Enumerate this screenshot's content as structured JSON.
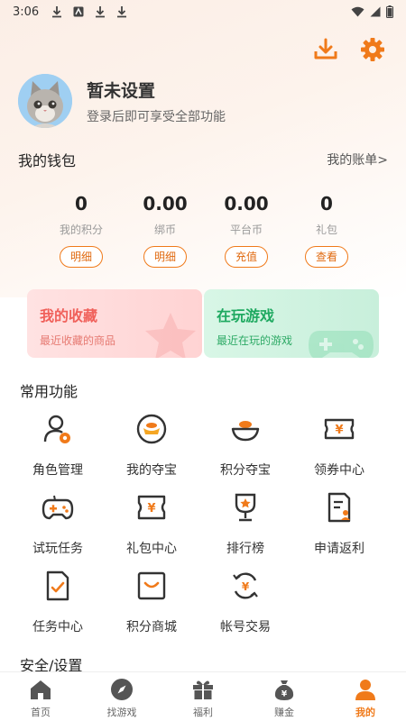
{
  "status_bar": {
    "time": "3:06"
  },
  "profile": {
    "name": "暂未设置",
    "login_tip": "登录后即可享受全部功能"
  },
  "wallet": {
    "title": "我的钱包",
    "bill_link": "我的账单>",
    "stats": [
      {
        "value": "0",
        "label": "我的积分",
        "button": "明细"
      },
      {
        "value": "0.00",
        "label": "绑币",
        "button": "明细"
      },
      {
        "value": "0.00",
        "label": "平台币",
        "button": "充值"
      },
      {
        "value": "0",
        "label": "礼包",
        "button": "查看"
      }
    ]
  },
  "cards": {
    "favorites": {
      "title": "我的收藏",
      "subtitle": "最近收藏的商品"
    },
    "playing": {
      "title": "在玩游戏",
      "subtitle": "最近在玩的游戏"
    }
  },
  "common_functions": {
    "title": "常用功能",
    "items": [
      {
        "label": "角色管理",
        "icon": "role-manage-icon"
      },
      {
        "label": "我的夺宝",
        "icon": "my-treasure-icon"
      },
      {
        "label": "积分夺宝",
        "icon": "points-treasure-icon"
      },
      {
        "label": "领券中心",
        "icon": "coupon-center-icon"
      },
      {
        "label": "试玩任务",
        "icon": "trial-task-icon"
      },
      {
        "label": "礼包中心",
        "icon": "gift-center-icon"
      },
      {
        "label": "排行榜",
        "icon": "leaderboard-icon"
      },
      {
        "label": "申请返利",
        "icon": "rebate-apply-icon"
      },
      {
        "label": "任务中心",
        "icon": "task-center-icon"
      },
      {
        "label": "积分商城",
        "icon": "points-mall-icon"
      },
      {
        "label": "帐号交易",
        "icon": "account-trade-icon"
      }
    ]
  },
  "security": {
    "title": "安全/设置"
  },
  "tabbar": {
    "items": [
      {
        "label": "首页",
        "icon": "home-icon"
      },
      {
        "label": "找游戏",
        "icon": "compass-icon"
      },
      {
        "label": "福利",
        "icon": "gift-icon"
      },
      {
        "label": "赚金",
        "icon": "money-bag-icon"
      },
      {
        "label": "我的",
        "icon": "user-icon",
        "active": true
      }
    ]
  },
  "colors": {
    "accent": "#f07a1a",
    "favorites": "#f0605a",
    "playing": "#1ea960"
  }
}
